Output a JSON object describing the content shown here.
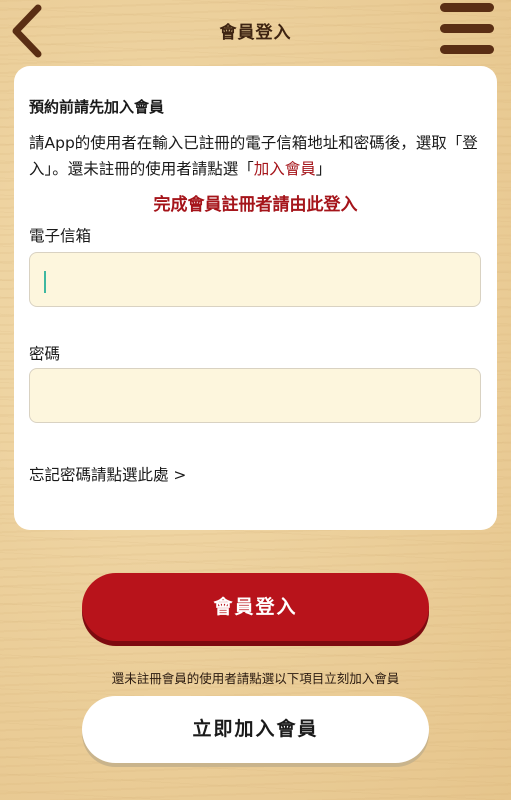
{
  "header": {
    "title": "會員登入",
    "back_icon": "chevron-left-icon",
    "menu_icon": "hamburger-menu-icon"
  },
  "card": {
    "heading": "預約前請先加入會員",
    "description_prefix": "請App的使用者在輸入已註冊的電子信箱地址和密碼後，選取「登入」。還未註冊的使用者請點選「",
    "join_link": "加入會員",
    "description_suffix": "」",
    "notice": "完成會員註冊者請由此登入",
    "email_label": "電子信箱",
    "email_value": "",
    "email_placeholder": "",
    "password_label": "密碼",
    "password_value": "",
    "password_placeholder": "",
    "forgot_password": "忘記密碼請點選此處 >"
  },
  "actions": {
    "login_label": "會員登入",
    "join_hint": "還未註冊會員的使用者請點選以下項目立刻加入會員",
    "join_label": "立即加入會員"
  },
  "colors": {
    "accent_red": "#b8131b",
    "link_red": "#a5141a",
    "input_bg": "#fdf6dd",
    "brown": "#5a2e14"
  }
}
